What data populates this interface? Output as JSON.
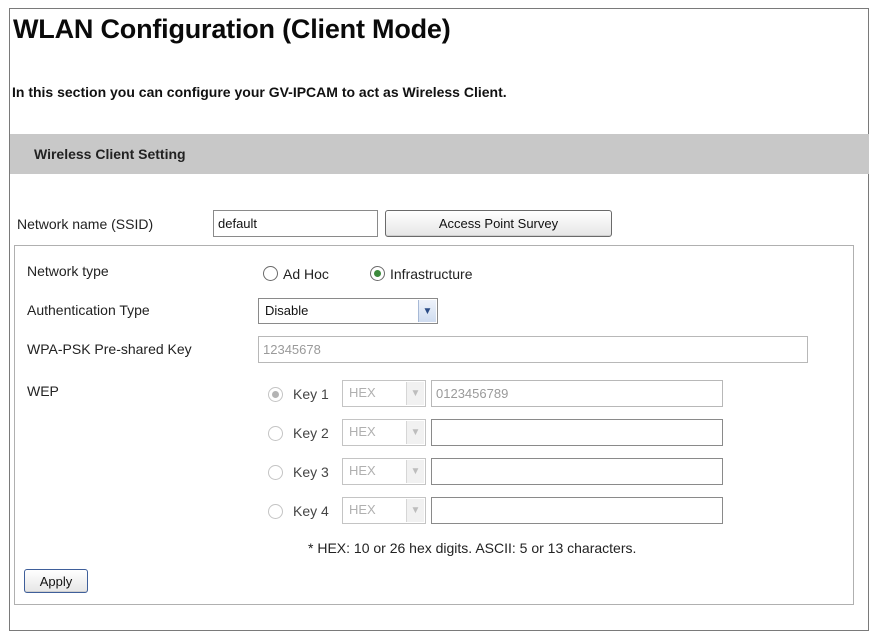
{
  "page": {
    "title": "WLAN Configuration (Client Mode)",
    "intro": "In this section you can configure your GV-IPCAM to act as Wireless Client."
  },
  "section": {
    "title": "Wireless Client Setting"
  },
  "ssid": {
    "label": "Network name (SSID)",
    "value": "default",
    "survey_button": "Access Point Survey"
  },
  "network_type": {
    "label": "Network type",
    "options": [
      {
        "label": "Ad Hoc",
        "selected": false
      },
      {
        "label": "Infrastructure",
        "selected": true
      }
    ]
  },
  "auth": {
    "label": "Authentication Type",
    "value": "Disable"
  },
  "wpa": {
    "label": "WPA-PSK Pre-shared Key",
    "value": "12345678"
  },
  "wep": {
    "label": "WEP",
    "keys": [
      {
        "label": "Key 1",
        "format": "HEX",
        "value": "0123456789",
        "selected": true
      },
      {
        "label": "Key 2",
        "format": "HEX",
        "value": "",
        "selected": false
      },
      {
        "label": "Key 3",
        "format": "HEX",
        "value": "",
        "selected": false
      },
      {
        "label": "Key 4",
        "format": "HEX",
        "value": "",
        "selected": false
      }
    ],
    "note": "* HEX: 10 or 26 hex digits. ASCII: 5 or 13 characters."
  },
  "actions": {
    "apply": "Apply"
  },
  "colors": {
    "section_bar": "#c8c8c8",
    "radio_checked": "#3c8a3c"
  }
}
